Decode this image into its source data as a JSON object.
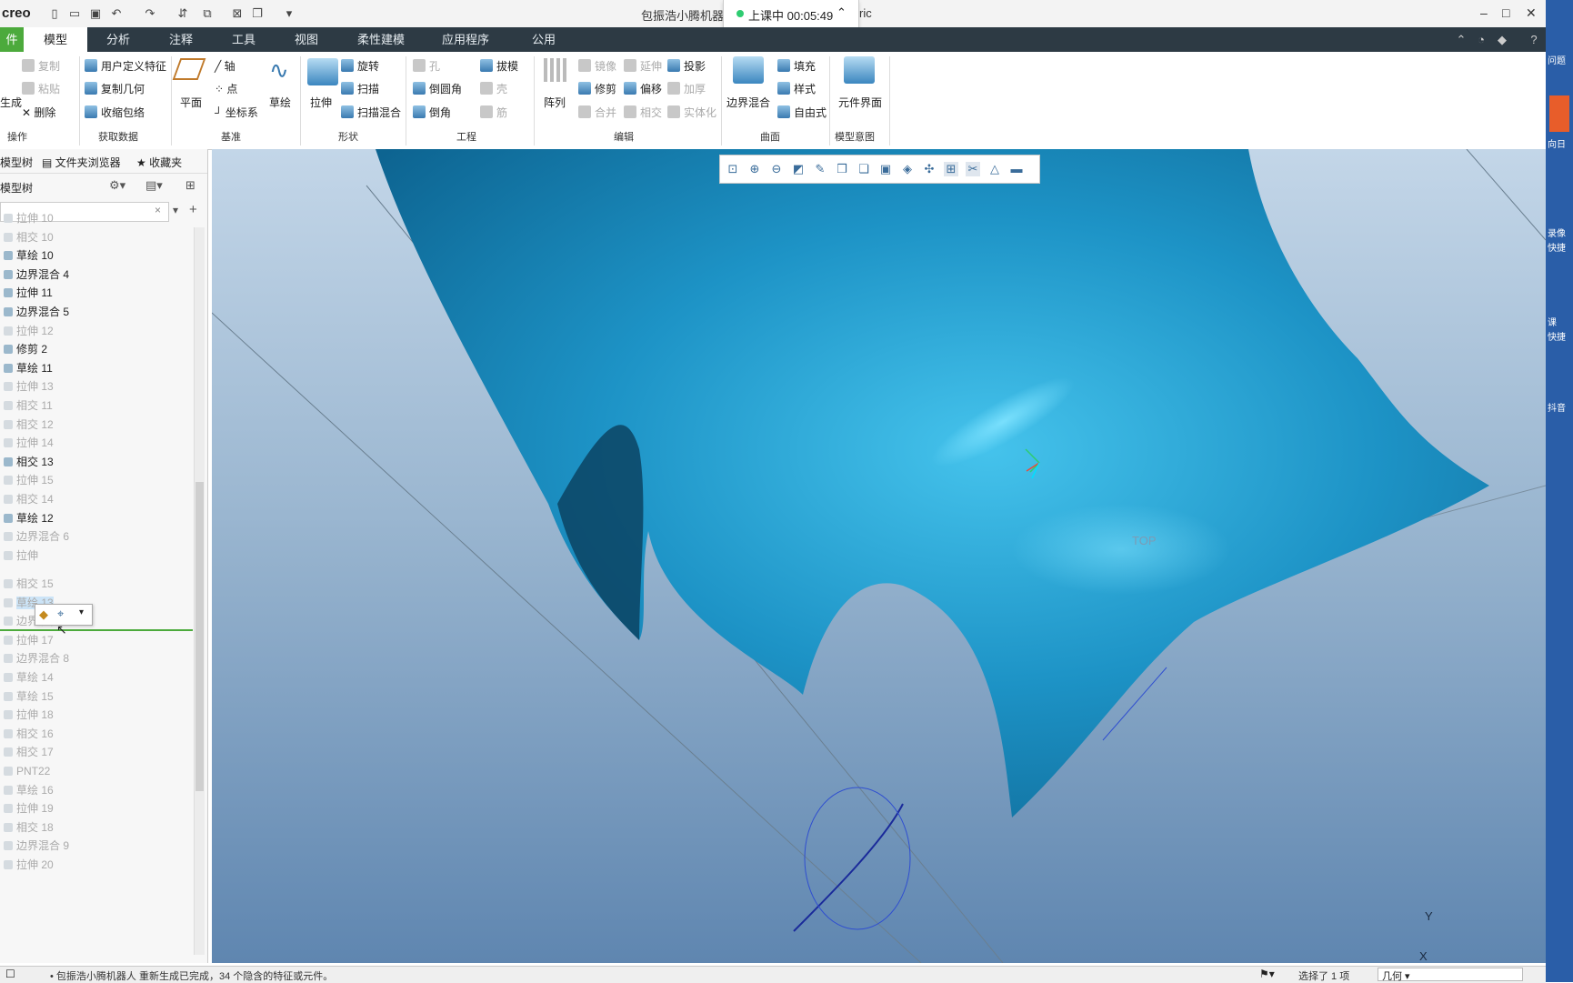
{
  "titlebar": {
    "app_logo": "creo",
    "title": "包振浩小腾机器",
    "title_suffix": "ric",
    "timer": {
      "status": "上课中",
      "time": "00:05:49"
    },
    "window_controls": [
      "–",
      "□",
      "✕"
    ]
  },
  "tabs": [
    "件",
    "模型",
    "分析",
    "注释",
    "工具",
    "视图",
    "柔性建模",
    "应用程序",
    "公用"
  ],
  "active_tab": "模型",
  "ribbon": {
    "operations": {
      "items": [
        "复制",
        "粘贴",
        "删除"
      ],
      "regen": "生成",
      "group": "操作"
    },
    "get_data": {
      "items": [
        "用户定义特征",
        "复制几何",
        "收缩包络"
      ],
      "group": "获取数据"
    },
    "datum": {
      "plane": "平面",
      "items": [
        "轴",
        "点",
        "坐标系"
      ],
      "sketch": "草绘",
      "group": "基准"
    },
    "shapes": {
      "extrude": "拉伸",
      "items": [
        "旋转",
        "扫描",
        "扫描混合"
      ],
      "group": "形状"
    },
    "engineering": {
      "items": [
        "孔",
        "倒圆角",
        "倒角",
        "拔模",
        "壳",
        "筋"
      ],
      "group": "工程"
    },
    "editing": {
      "pattern": "阵列",
      "items": [
        "镜像",
        "修剪",
        "合并",
        "延伸",
        "偏移",
        "相交",
        "投影",
        "加厚",
        "实体化"
      ],
      "group": "编辑"
    },
    "surfaces": {
      "boundary": "边界混合",
      "items": [
        "填充",
        "样式",
        "自由式"
      ],
      "group": "曲面"
    },
    "model_intent": {
      "component": "元件界面",
      "group": "模型意图"
    }
  },
  "left_panel": {
    "tabs": [
      "模型树",
      "文件夹浏览器",
      "收藏夹"
    ],
    "tree_title": "模型树",
    "items": [
      {
        "label": "拉伸 10",
        "dim": true
      },
      {
        "label": "相交 10",
        "dim": true
      },
      {
        "label": "草绘 10",
        "dim": false
      },
      {
        "label": "边界混合 4",
        "dim": false
      },
      {
        "label": "拉伸 11",
        "dim": false
      },
      {
        "label": "边界混合 5",
        "dim": false
      },
      {
        "label": "拉伸 12",
        "dim": true
      },
      {
        "label": "修剪 2",
        "dim": false
      },
      {
        "label": "草绘 11",
        "dim": false
      },
      {
        "label": "拉伸 13",
        "dim": true
      },
      {
        "label": "相交 11",
        "dim": true
      },
      {
        "label": "相交 12",
        "dim": true
      },
      {
        "label": "拉伸 14",
        "dim": true
      },
      {
        "label": "相交 13",
        "dim": false
      },
      {
        "label": "拉伸 15",
        "dim": true
      },
      {
        "label": "相交 14",
        "dim": true
      },
      {
        "label": "草绘 12",
        "dim": false
      },
      {
        "label": "边界混合 6",
        "dim": true
      },
      {
        "label": "拉伸",
        "dim": true
      }
    ],
    "items_after": [
      {
        "label": "相交 15",
        "hi": false
      },
      {
        "label": "草绘 13",
        "hi": true
      },
      {
        "label": "边界混合 7",
        "hi": false
      },
      {
        "label": "拉伸 17",
        "hi": false
      },
      {
        "label": "边界混合 8",
        "hi": false
      },
      {
        "label": "草绘 14",
        "hi": false
      },
      {
        "label": "草绘 15",
        "hi": false
      },
      {
        "label": "拉伸 18",
        "hi": false
      },
      {
        "label": "相交 16",
        "hi": false
      },
      {
        "label": "相交 17",
        "hi": false
      },
      {
        "label": "PNT22",
        "hi": false
      },
      {
        "label": "草绘 16",
        "hi": false
      },
      {
        "label": "拉伸 19",
        "hi": false
      },
      {
        "label": "相交 18",
        "hi": false
      },
      {
        "label": "边界混合 9",
        "hi": false
      },
      {
        "label": "拉伸 20",
        "hi": false
      }
    ]
  },
  "viewport": {
    "datum_label": "TOP",
    "axis_y": "Y",
    "axis_x": "X"
  },
  "right_edge": [
    "问题",
    "向日",
    "录像",
    "快捷",
    "课",
    "快捷",
    "抖音"
  ],
  "statusbar": {
    "message": "• 包振浩小腾机器人 重新生成已完成，34 个隐含的特征或元件。",
    "selection": "选择了 1 项",
    "filter": "几何"
  },
  "colors": {
    "surface": "#1b8fc0",
    "tabbar": "#2d3a44",
    "file_tab": "#4caa3c"
  }
}
